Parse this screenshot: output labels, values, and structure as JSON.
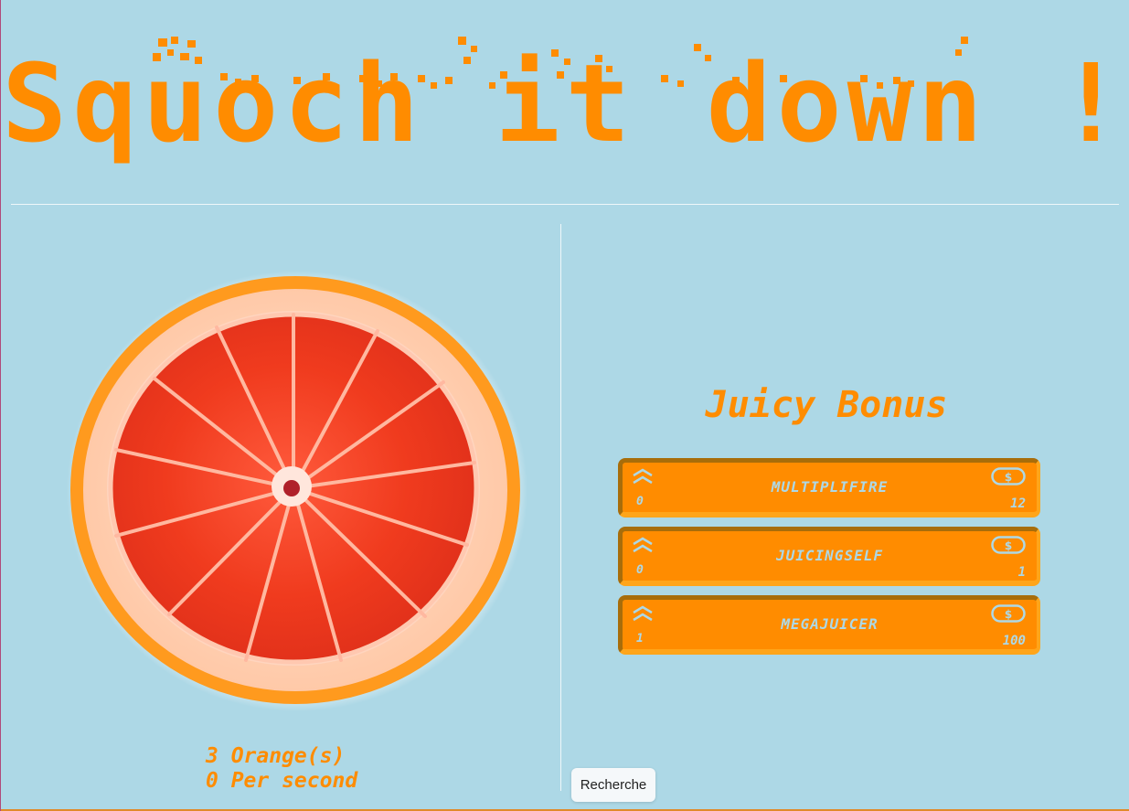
{
  "header": {
    "title": "Squoch it down !"
  },
  "counter": {
    "oranges": "3 Orange(s)",
    "per_second": "0 Per second"
  },
  "bonus_panel": {
    "title": "Juicy Bonus",
    "items": [
      {
        "name": "MULTIPLIFIRE",
        "level": "0",
        "price": "12"
      },
      {
        "name": "JUICINGSELF",
        "level": "0",
        "price": "1"
      },
      {
        "name": "MEGAJUICER",
        "level": "1",
        "price": "100"
      }
    ]
  },
  "search_chip": {
    "label": "Recherche"
  },
  "colors": {
    "background": "#add8e6",
    "accent": "#ff8c00",
    "card_shadow": "#a86d0a",
    "card_highlight": "#ffa51a"
  },
  "icons": {
    "level": "chevron-double-up-icon",
    "price": "coin-dollar-icon"
  }
}
